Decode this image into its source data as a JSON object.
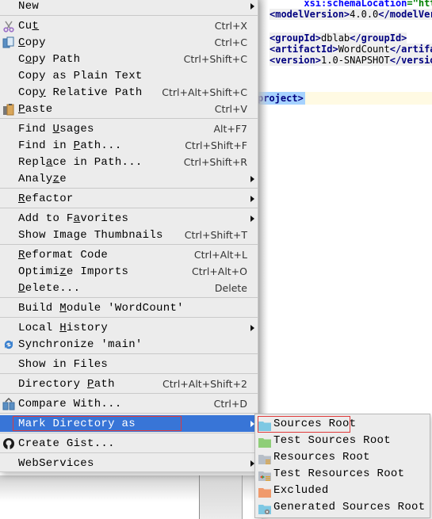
{
  "editor": {
    "lines": [
      {
        "parts": [
          {
            "t": "      ",
            "c": ""
          },
          {
            "t": "xsi:schemaLocation",
            "c": "attr"
          },
          {
            "t": "=\"http:",
            "c": "str"
          }
        ]
      },
      {
        "parts": [
          {
            "t": "<modelVersion>",
            "c": "tag"
          },
          {
            "t": "4.0.0",
            "c": ""
          },
          {
            "t": "</modelVers",
            "c": "tag"
          }
        ]
      },
      {
        "parts": []
      },
      {
        "parts": [
          {
            "t": "<groupId>",
            "c": "tag"
          },
          {
            "t": "dblab",
            "c": ""
          },
          {
            "t": "</groupId>",
            "c": "tag"
          }
        ]
      },
      {
        "parts": [
          {
            "t": "<artifactId>",
            "c": "tag"
          },
          {
            "t": "WordCount",
            "c": ""
          },
          {
            "t": "</artifa",
            "c": "tag"
          }
        ]
      },
      {
        "parts": [
          {
            "t": "<version>",
            "c": "tag"
          },
          {
            "t": "1.0-SNAPSHOT",
            "c": ""
          },
          {
            "t": "</version",
            "c": "tag"
          }
        ]
      }
    ],
    "closing_tag": "project>"
  },
  "menu": {
    "groups": [
      [
        {
          "label": "New",
          "mnemonic": -1,
          "shortcut": "",
          "submenu": true,
          "icon": ""
        }
      ],
      [
        {
          "label": "Cut",
          "mnemonic": 2,
          "shortcut": "Ctrl+X",
          "submenu": false,
          "icon": "scissors-icon"
        },
        {
          "label": "Copy",
          "mnemonic": 0,
          "shortcut": "Ctrl+C",
          "submenu": false,
          "icon": "copy-icon"
        },
        {
          "label": "Copy Path",
          "mnemonic": 1,
          "shortcut": "Ctrl+Shift+C",
          "submenu": false,
          "icon": ""
        },
        {
          "label": "Copy as Plain Text",
          "mnemonic": -1,
          "shortcut": "",
          "submenu": false,
          "icon": ""
        },
        {
          "label": "Copy Relative Path",
          "mnemonic": 3,
          "shortcut": "Ctrl+Alt+Shift+C",
          "submenu": false,
          "icon": ""
        },
        {
          "label": "Paste",
          "mnemonic": 0,
          "shortcut": "Ctrl+V",
          "submenu": false,
          "icon": "paste-icon"
        }
      ],
      [
        {
          "label": "Find Usages",
          "mnemonic": 5,
          "shortcut": "Alt+F7",
          "submenu": false,
          "icon": ""
        },
        {
          "label": "Find in Path...",
          "mnemonic": 8,
          "shortcut": "Ctrl+Shift+F",
          "submenu": false,
          "icon": ""
        },
        {
          "label": "Replace in Path...",
          "mnemonic": 4,
          "shortcut": "Ctrl+Shift+R",
          "submenu": false,
          "icon": ""
        },
        {
          "label": "Analyze",
          "mnemonic": 5,
          "shortcut": "",
          "submenu": true,
          "icon": ""
        }
      ],
      [
        {
          "label": "Refactor",
          "mnemonic": 0,
          "shortcut": "",
          "submenu": true,
          "icon": ""
        }
      ],
      [
        {
          "label": "Add to Favorites",
          "mnemonic": 8,
          "shortcut": "",
          "submenu": true,
          "icon": ""
        },
        {
          "label": "Show Image Thumbnails",
          "mnemonic": -1,
          "shortcut": "Ctrl+Shift+T",
          "submenu": false,
          "icon": ""
        }
      ],
      [
        {
          "label": "Reformat Code",
          "mnemonic": 0,
          "shortcut": "Ctrl+Alt+L",
          "submenu": false,
          "icon": ""
        },
        {
          "label": "Optimize Imports",
          "mnemonic": 6,
          "shortcut": "Ctrl+Alt+O",
          "submenu": false,
          "icon": ""
        },
        {
          "label": "Delete...",
          "mnemonic": 0,
          "shortcut": "Delete",
          "submenu": false,
          "icon": ""
        }
      ],
      [
        {
          "label": "Build Module 'WordCount'",
          "mnemonic": 6,
          "shortcut": "",
          "submenu": false,
          "icon": ""
        }
      ],
      [
        {
          "label": "Local History",
          "mnemonic": 6,
          "shortcut": "",
          "submenu": true,
          "icon": ""
        },
        {
          "label": "Synchronize 'main'",
          "mnemonic": -1,
          "shortcut": "",
          "submenu": false,
          "icon": "sync-icon"
        }
      ],
      [
        {
          "label": "Show in Files",
          "mnemonic": -1,
          "shortcut": "",
          "submenu": false,
          "icon": ""
        }
      ],
      [
        {
          "label": "Directory Path",
          "mnemonic": 10,
          "shortcut": "Ctrl+Alt+Shift+2",
          "submenu": false,
          "icon": ""
        }
      ],
      [
        {
          "label": "Compare With...",
          "mnemonic": -1,
          "shortcut": "Ctrl+D",
          "submenu": false,
          "icon": "compare-icon"
        }
      ],
      [
        {
          "label": "Mark Directory as",
          "mnemonic": -1,
          "shortcut": "",
          "submenu": true,
          "icon": "",
          "highlighted": true
        }
      ],
      [
        {
          "label": "Create Gist...",
          "mnemonic": -1,
          "shortcut": "",
          "submenu": false,
          "icon": "github-icon"
        }
      ],
      [
        {
          "label": "WebServices",
          "mnemonic": -1,
          "shortcut": "",
          "submenu": true,
          "icon": ""
        }
      ]
    ]
  },
  "submenu": {
    "items": [
      {
        "label": "Sources Root",
        "icon": "sources-root-folder-icon",
        "color": "#7ec8e3",
        "outlined": true
      },
      {
        "label": "Test Sources Root",
        "icon": "test-sources-root-folder-icon",
        "color": "#8fce78"
      },
      {
        "label": "Resources Root",
        "icon": "resources-root-folder-icon",
        "color": "#b7bec7"
      },
      {
        "label": "Test Resources Root",
        "icon": "test-resources-root-folder-icon",
        "color": "#b7bec7"
      },
      {
        "label": "Excluded",
        "icon": "excluded-folder-icon",
        "color": "#f09a6c"
      },
      {
        "label": "Generated Sources Root",
        "icon": "generated-sources-root-folder-icon",
        "color": "#7ec8e3"
      }
    ]
  },
  "colors": {
    "menu_bg": "#ececec",
    "highlight": "#3875d7",
    "annotation_box": "#e03a3a"
  }
}
